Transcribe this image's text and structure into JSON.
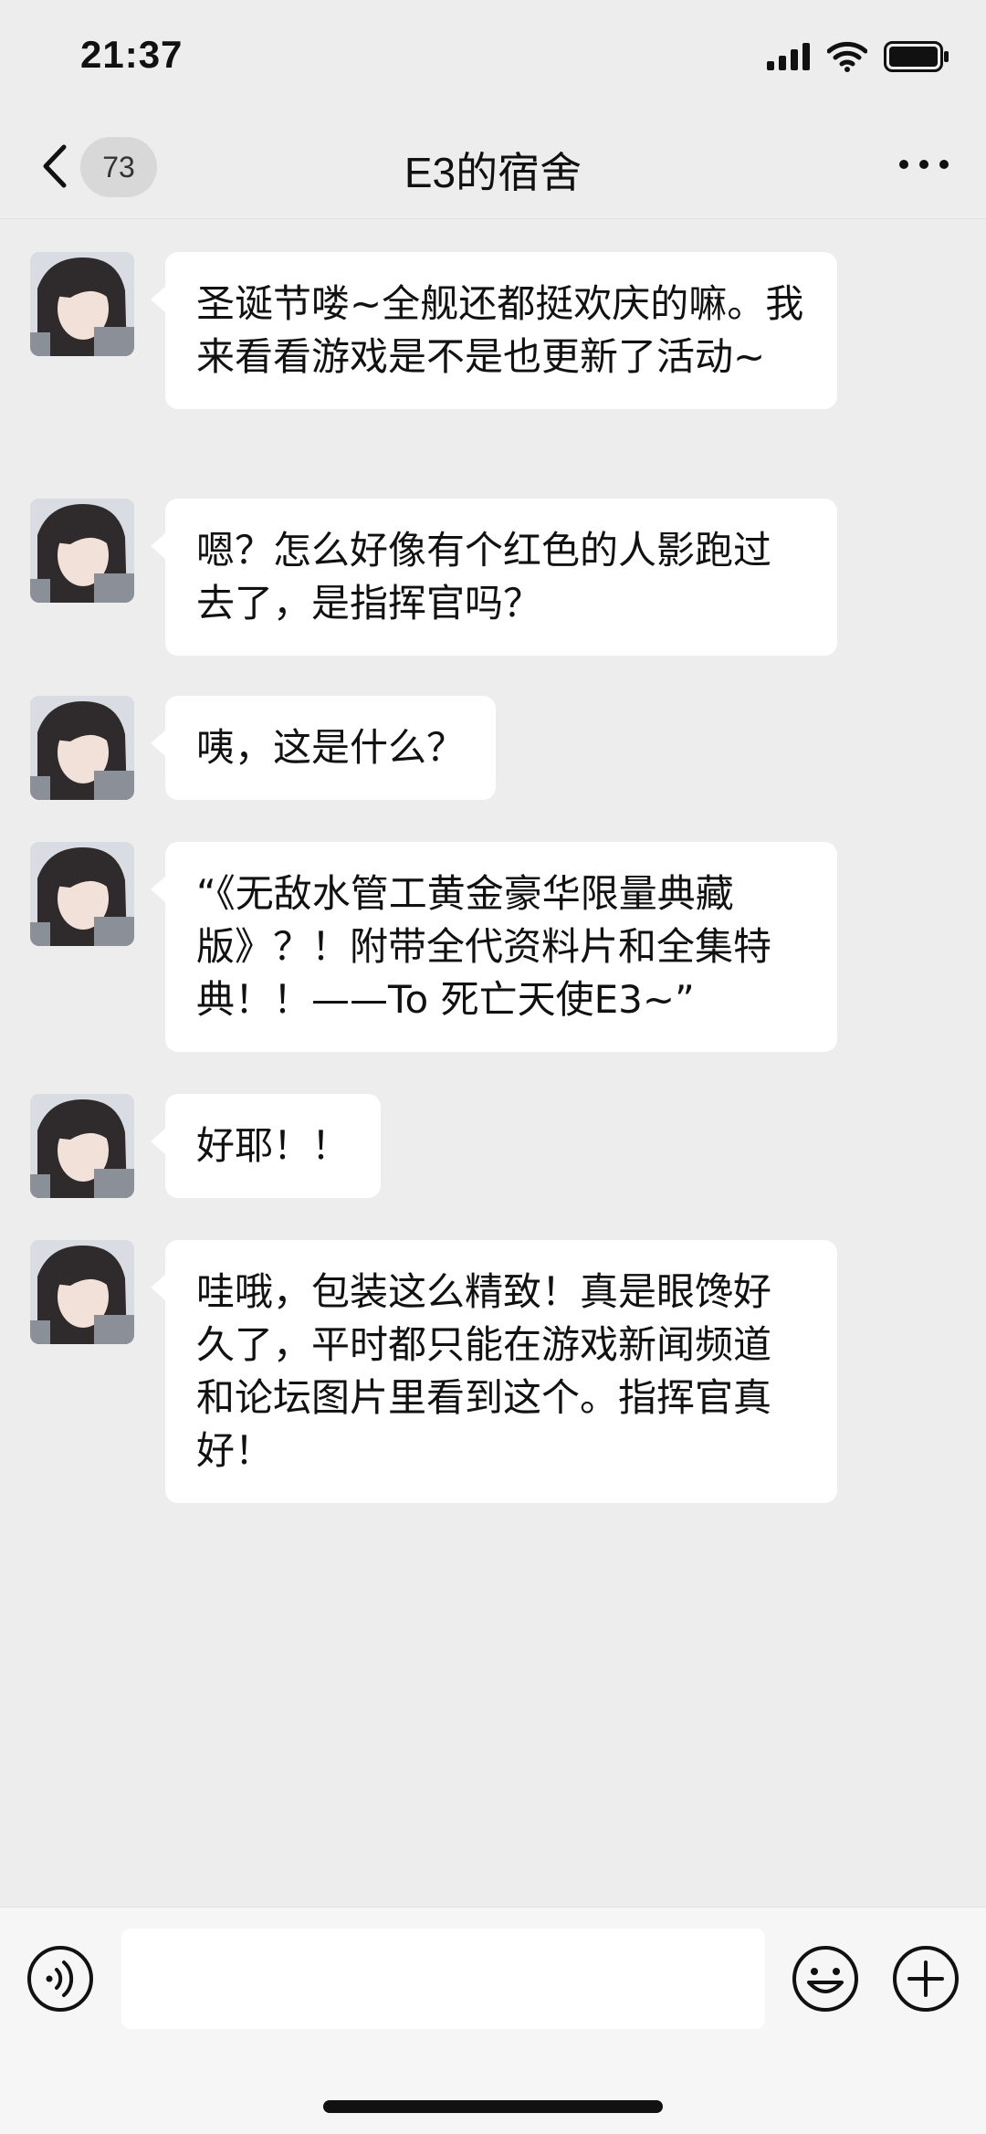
{
  "status_bar": {
    "time": "21:37",
    "icons": [
      "signal-icon",
      "wifi-icon",
      "battery-icon"
    ]
  },
  "nav": {
    "back_icon": "chevron-left-icon",
    "unread_count": "73",
    "title": "E3的宿舍",
    "more_icon": "more-dots-icon"
  },
  "messages": [
    {
      "sender": "avatar",
      "text": "圣诞节喽~全舰还都挺欢庆的嘛。我来看看游戏是不是也更新了活动~"
    },
    {
      "sender": "avatar",
      "text": "嗯？怎么好像有个红色的人影跑过去了，是指挥官吗？"
    },
    {
      "sender": "avatar",
      "text": "咦，这是什么？"
    },
    {
      "sender": "avatar",
      "text": "“《无敌水管工黄金豪华限量典藏版》？！附带全代资料片和全集特典！！——To 死亡天使E3~”"
    },
    {
      "sender": "avatar",
      "text": "好耶！！"
    },
    {
      "sender": "avatar",
      "text": "哇哦，包装这么精致！真是眼馋好久了，平时都只能在游戏新闻频道和论坛图片里看到这个。指挥官真好！"
    }
  ],
  "input_bar": {
    "voice_icon": "voice-icon",
    "input_value": "",
    "emoji_icon": "emoji-icon",
    "plus_icon": "plus-icon"
  },
  "colors": {
    "background": "#ededed",
    "bubble": "#ffffff",
    "input_bar": "#f6f6f6"
  }
}
